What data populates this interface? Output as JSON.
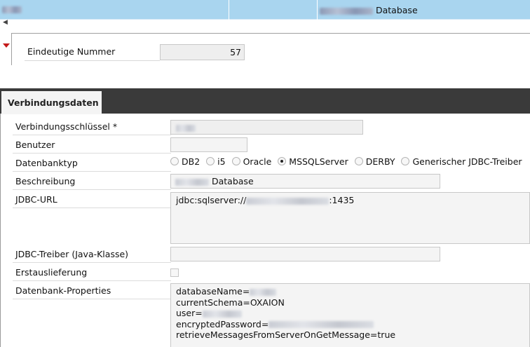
{
  "top_row": {
    "database_label": "Database"
  },
  "record": {
    "label": "Eindeutige Nummer",
    "value": "57"
  },
  "tabs": [
    {
      "label": "Verbindungsdaten",
      "active": true
    }
  ],
  "form": {
    "key_label": "Verbindungsschlüssel *",
    "user_label": "Benutzer",
    "db_type_label": "Datenbanktyp",
    "db_types": [
      "DB2",
      "i5",
      "Oracle",
      "MSSQLServer",
      "DERBY",
      "Generischer JDBC-Treiber"
    ],
    "db_type_selected": "MSSQLServer",
    "description_label": "Beschreibung",
    "description_suffix": "Database",
    "jdbc_url_label": "JDBC-URL",
    "jdbc_url_prefix": "jdbc:sqlserver://",
    "jdbc_url_suffix": ":1435",
    "driver_label": "JDBC-Treiber (Java-Klasse)",
    "first_delivery_label": "Erstauslieferung",
    "first_delivery_checked": false,
    "properties_label": "Datenbank-Properties",
    "properties": {
      "line1": "databaseName=",
      "line2": "currentSchema=OXAION",
      "line3": "user=",
      "line4": "encryptedPassword=",
      "line5": "retrieveMessagesFromServerOnGetMessage=true"
    }
  },
  "colors": {
    "selection": "#a9d5ef",
    "tab_bar": "#3a3a3a",
    "marker": "#c41a1a"
  }
}
